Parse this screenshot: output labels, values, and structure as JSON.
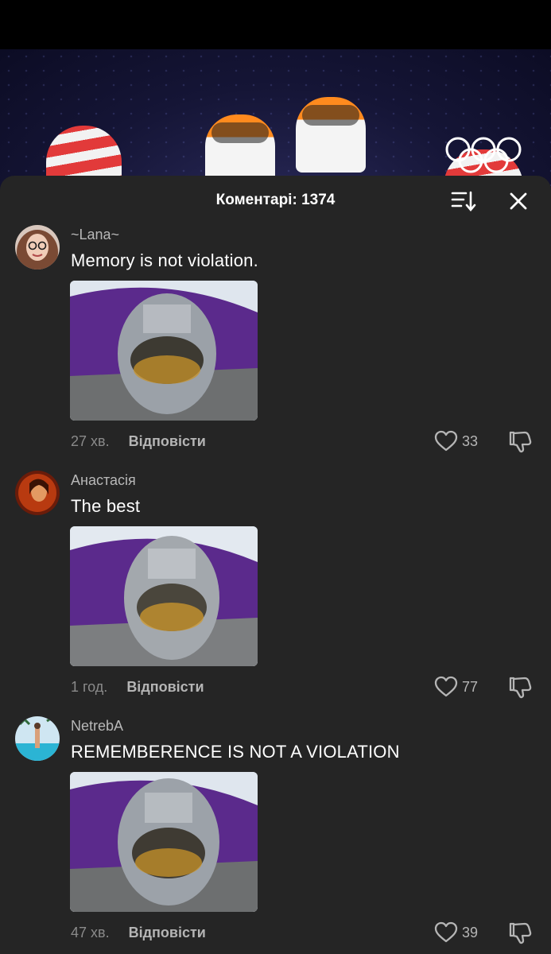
{
  "header": {
    "title": "Коментарі: 1374",
    "sort_icon": "sort-icon",
    "close_icon": "close-icon"
  },
  "colors": {
    "sheet_bg": "#252525",
    "text_primary": "#ffffff",
    "text_secondary": "#b8b8b8",
    "text_muted": "#8a8a8a"
  },
  "comments": [
    {
      "username": "~Lana~",
      "text": "Memory is not violation.",
      "time": "27 хв.",
      "reply_label": "Відповісти",
      "likes": "33"
    },
    {
      "username": "Анастасія",
      "text": "The best",
      "time": "1 год.",
      "reply_label": "Відповісти",
      "likes": "77"
    },
    {
      "username": "NetrebA",
      "text": "REMEMBERENCE IS NOT A VIOLATION",
      "time": "47 хв.",
      "reply_label": "Відповісти",
      "likes": "39"
    }
  ]
}
